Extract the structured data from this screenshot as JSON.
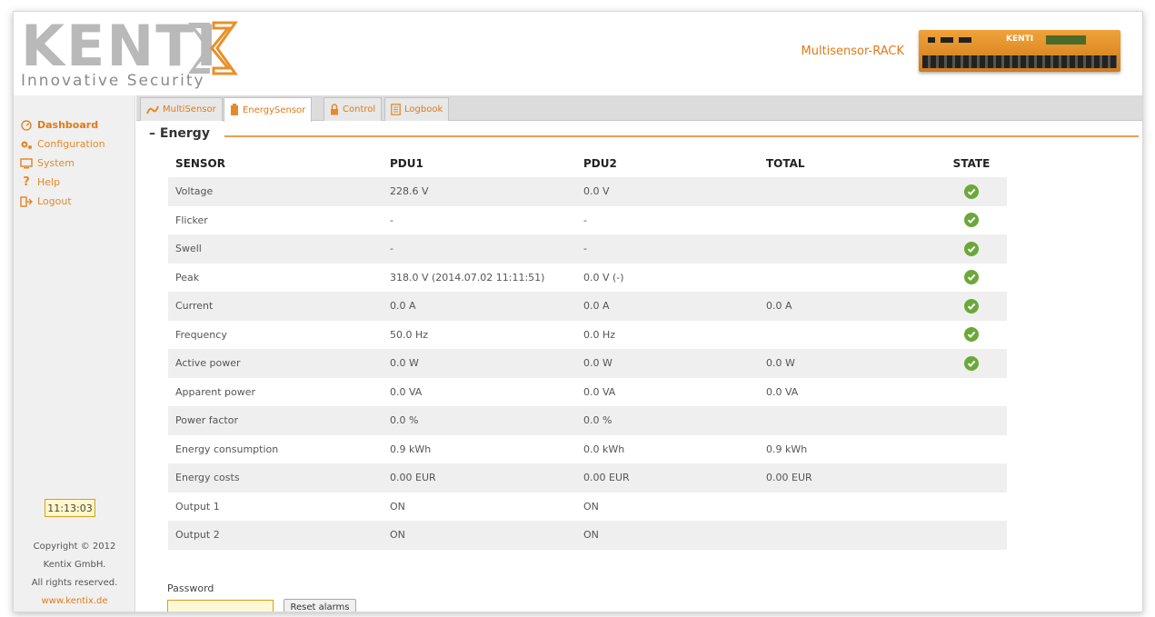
{
  "header": {
    "logo_text": "KENTIX",
    "logo_word": "KENTI",
    "tagline": "Innovative Security",
    "device_name": "Multisensor-RACK",
    "device_brand": "KENTI"
  },
  "sidebar": {
    "items": [
      {
        "label": "Dashboard",
        "icon": "dashboard-icon",
        "active": true
      },
      {
        "label": "Configuration",
        "icon": "gears-icon"
      },
      {
        "label": "System",
        "icon": "monitor-icon"
      },
      {
        "label": "Help",
        "icon": "question-icon"
      },
      {
        "label": "Logout",
        "icon": "logout-icon"
      }
    ],
    "clock": "11:13:03",
    "copyright_line1": "Copyright © 2012",
    "copyright_line2": "Kentix GmbH.",
    "copyright_line3": "All rights reserved.",
    "website": "www.kentix.de"
  },
  "tabs": [
    {
      "label": "MultiSensor",
      "icon": "sensor-icon"
    },
    {
      "label": "EnergySensor",
      "icon": "battery-icon",
      "active": true
    },
    {
      "label": "Control",
      "icon": "lock-icon"
    },
    {
      "label": "Logbook",
      "icon": "logbook-icon"
    }
  ],
  "section_title": "Energy",
  "table": {
    "headers": [
      "SENSOR",
      "PDU1",
      "PDU2",
      "TOTAL",
      "STATE"
    ],
    "rows": [
      {
        "sensor": "Voltage",
        "pdu1": "228.6 V",
        "pdu2": "0.0 V",
        "total": "",
        "state": "ok"
      },
      {
        "sensor": "Flicker",
        "pdu1": "-",
        "pdu2": "-",
        "total": "",
        "state": "ok"
      },
      {
        "sensor": "Swell",
        "pdu1": "-",
        "pdu2": "-",
        "total": "",
        "state": "ok"
      },
      {
        "sensor": "Peak",
        "pdu1": "318.0 V (2014.07.02 11:11:51)",
        "pdu2": "0.0 V (-)",
        "total": "",
        "state": "ok"
      },
      {
        "sensor": "Current",
        "pdu1": "0.0 A",
        "pdu2": "0.0 A",
        "total": "0.0 A",
        "state": "ok"
      },
      {
        "sensor": "Frequency",
        "pdu1": "50.0 Hz",
        "pdu2": "0.0 Hz",
        "total": "",
        "state": "ok"
      },
      {
        "sensor": "Active power",
        "pdu1": "0.0 W",
        "pdu2": "0.0 W",
        "total": "0.0 W",
        "state": "ok"
      },
      {
        "sensor": "Apparent power",
        "pdu1": "0.0 VA",
        "pdu2": "0.0 VA",
        "total": "0.0 VA",
        "state": ""
      },
      {
        "sensor": "Power factor",
        "pdu1": "0.0 %",
        "pdu2": "0.0 %",
        "total": "",
        "state": ""
      },
      {
        "sensor": "Energy consumption",
        "pdu1": "0.9 kWh",
        "pdu2": "0.0 kWh",
        "total": "0.9 kWh",
        "state": ""
      },
      {
        "sensor": "Energy costs",
        "pdu1": "0.00 EUR",
        "pdu2": "0.00 EUR",
        "total": "0.00 EUR",
        "state": ""
      },
      {
        "sensor": "Output 1",
        "pdu1": "ON",
        "pdu2": "ON",
        "total": "",
        "state": ""
      },
      {
        "sensor": "Output 2",
        "pdu1": "ON",
        "pdu2": "ON",
        "total": "",
        "state": ""
      }
    ]
  },
  "password": {
    "label": "Password",
    "value": ""
  },
  "reset_button": "Reset alarms",
  "colors": {
    "accent": "#e07a17",
    "ok": "#6ba83a",
    "logo_gray": "#b9b9b9"
  }
}
